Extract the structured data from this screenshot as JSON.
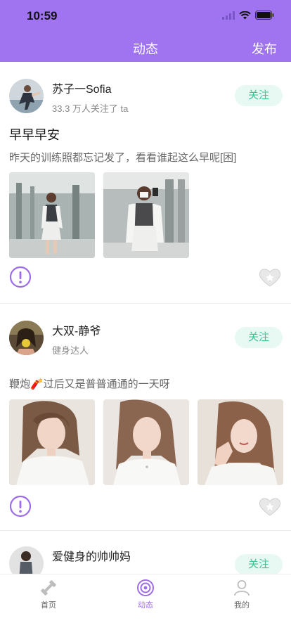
{
  "status_bar": {
    "time": "10:59"
  },
  "header": {
    "title": "动态",
    "publish": "发布"
  },
  "posts": [
    {
      "name": "苏子一Sofia",
      "subtitle": "33.3 万人关注了 ta",
      "follow_label": "关注",
      "title": "早早早安",
      "text": "昨天的训练照都忘记发了，看看谁起这么早呢[困]"
    },
    {
      "name": "大双-静爷",
      "subtitle": "健身达人",
      "follow_label": "关注",
      "text": "鞭炮🧨过后又是普普通通的一天呀"
    },
    {
      "name": "爱健身的帅帅妈",
      "follow_label": "关注"
    }
  ],
  "tabs": [
    {
      "label": "首页",
      "icon": "dumbbell-icon"
    },
    {
      "label": "动态",
      "icon": "target-icon"
    },
    {
      "label": "我的",
      "icon": "person-icon"
    }
  ],
  "colors": {
    "accent": "#a074f0",
    "follow_bg": "#e7f9f2",
    "follow_text": "#36c692"
  }
}
